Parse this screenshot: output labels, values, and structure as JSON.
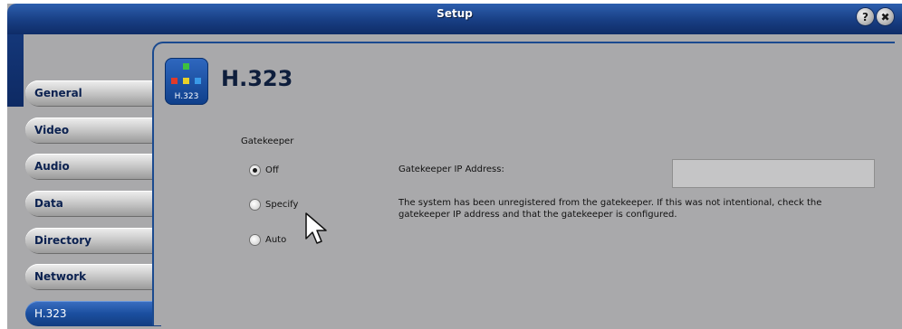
{
  "window": {
    "title": "Setup"
  },
  "titlebar": {
    "help_label": "?",
    "close_label": "✖"
  },
  "tabs": [
    {
      "label": "General",
      "active": false
    },
    {
      "label": "Video",
      "active": false
    },
    {
      "label": "Audio",
      "active": false
    },
    {
      "label": "Data",
      "active": false
    },
    {
      "label": "Directory",
      "active": false
    },
    {
      "label": "Network",
      "active": false
    },
    {
      "label": "H.323",
      "active": true
    }
  ],
  "section": {
    "title": "H.323",
    "icon_label": "H.323",
    "icon": "network-diagram-icon"
  },
  "gatekeeper": {
    "label": "Gatekeeper",
    "options": [
      {
        "label": "Off",
        "checked": true
      },
      {
        "label": "Specify",
        "checked": false
      },
      {
        "label": "Auto",
        "checked": false
      }
    ],
    "ip_label": "Gatekeeper IP Address:",
    "ip_value": "",
    "message": "The system has been unregistered from the gatekeeper. If this was not intentional, check the gatekeeper IP address and that the gatekeeper is configured."
  },
  "colors": {
    "accent": "#1b4f9f",
    "panel": "#a9a9ab",
    "titlebar": "#183e83"
  }
}
